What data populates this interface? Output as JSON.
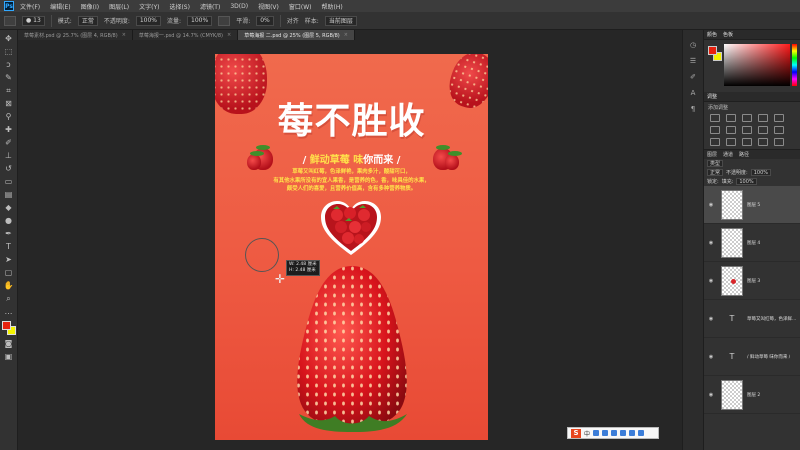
{
  "menubar": {
    "logo": "Ps",
    "items": [
      "文件(F)",
      "编辑(E)",
      "图像(I)",
      "图层(L)",
      "文字(Y)",
      "选择(S)",
      "滤镜(T)",
      "3D(D)",
      "视图(V)",
      "窗口(W)",
      "帮助(H)"
    ]
  },
  "options": {
    "mode_label": "模式:",
    "mode_value": "正常",
    "opacity_label": "不透明度:",
    "opacity_value": "100%",
    "flow_label": "流量:",
    "flow_value": "100%",
    "smooth_label": "平滑:",
    "smooth_value": "0%",
    "check_label": "对齐",
    "sample_label": "样本:",
    "sample_value": "当前图层"
  },
  "tabs": [
    {
      "label": "草莓素材.psd @ 25.7% (图层 4, RGB/8)",
      "active": false
    },
    {
      "label": "草莓海报一.psd @ 14.7% (CMYK/8)",
      "active": false
    },
    {
      "label": "草莓海报 二.psd @ 25% (图层 5, RGB/8)",
      "active": true
    }
  ],
  "poster": {
    "title": "莓不胜收",
    "slogan_pre": "/ ",
    "slogan_hl1": "鲜动草莓",
    "slogan_mid": " ",
    "slogan_hl2": "味",
    "slogan_post": "你而来 /",
    "desc_lines": [
      "草莓又叫红莓，色泽鲜艳，果肉多汁，酸甜可口，",
      "有其他水果所没有的宜人果香，是营养的色，香，味具佳的水果，",
      "颇受人们的喜爱，且营养价值高，含有多种营养物质。"
    ]
  },
  "cursor_tip": {
    "w": "W: 2.48 厘米",
    "h": "H: 2.48 厘米"
  },
  "ime": {
    "logo": "S",
    "text": "中"
  },
  "panels": {
    "color_tabs": [
      "颜色",
      "色板"
    ],
    "adjust_tabs": [
      "调整"
    ],
    "adjust_label": "添加调整",
    "layer_tabs": [
      "图层",
      "通道",
      "路径"
    ],
    "kind_label": "类型",
    "blend_value": "正常",
    "opacity_label": "不透明度:",
    "opacity_value": "100%",
    "lock_label": "锁定:",
    "fill_label": "填充:",
    "fill_value": "100%",
    "colors": {
      "fg": "#e8220f",
      "bg": "#f2f200"
    }
  },
  "layers": [
    {
      "name": "图层 5",
      "type": "pixel",
      "selected": true
    },
    {
      "name": "图层 4",
      "type": "pixel",
      "selected": false
    },
    {
      "name": "图层 3",
      "type": "pixel",
      "selected": false
    },
    {
      "name": "草莓又叫红莓，色泽鲜...",
      "type": "text",
      "selected": false
    },
    {
      "name": "/ 鲜动草莓 味你而来 /",
      "type": "text",
      "selected": false
    },
    {
      "name": "图层 2",
      "type": "pixel",
      "selected": false
    }
  ]
}
